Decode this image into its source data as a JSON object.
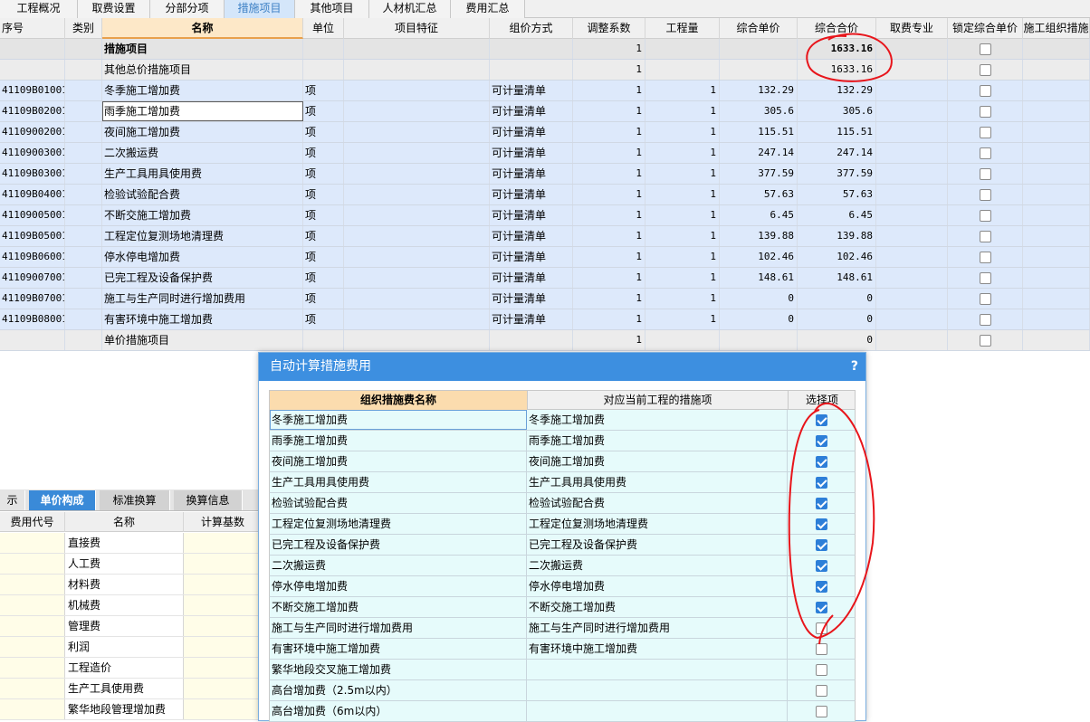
{
  "tabs": [
    "工程概况",
    "取费设置",
    "分部分项",
    "措施项目",
    "其他项目",
    "人材机汇总",
    "费用汇总"
  ],
  "active_tab": "措施项目",
  "grid": {
    "headers": [
      "序号",
      "类别",
      "名称",
      "单位",
      "项目特征",
      "组价方式",
      "调整系数",
      "工程量",
      "综合单价",
      "综合合价",
      "取费专业",
      "锁定综合单价",
      "施工组织措施"
    ],
    "rows": [
      {
        "code": "",
        "name": "措施项目",
        "unit": "",
        "method": "",
        "coef": "1",
        "qty": "",
        "price": "",
        "total": "1633.16",
        "kind": "total"
      },
      {
        "code": "",
        "name": "其他总价措施项目",
        "unit": "",
        "method": "",
        "coef": "1",
        "qty": "",
        "price": "",
        "total": "1633.16",
        "kind": "sub"
      },
      {
        "code": "41109B01001",
        "name": "冬季施工增加费",
        "unit": "项",
        "method": "可计量清单",
        "coef": "1",
        "qty": "1",
        "price": "132.29",
        "total": "132.29",
        "kind": "item"
      },
      {
        "code": "41109B02001",
        "name": "雨季施工增加费",
        "unit": "项",
        "method": "可计量清单",
        "coef": "1",
        "qty": "1",
        "price": "305.6",
        "total": "305.6",
        "kind": "item"
      },
      {
        "code": "41109002001",
        "name": "夜间施工增加费",
        "unit": "项",
        "method": "可计量清单",
        "coef": "1",
        "qty": "1",
        "price": "115.51",
        "total": "115.51",
        "kind": "item"
      },
      {
        "code": "41109003001",
        "name": "二次搬运费",
        "unit": "项",
        "method": "可计量清单",
        "coef": "1",
        "qty": "1",
        "price": "247.14",
        "total": "247.14",
        "kind": "item"
      },
      {
        "code": "41109B03001",
        "name": "生产工具用具使用费",
        "unit": "项",
        "method": "可计量清单",
        "coef": "1",
        "qty": "1",
        "price": "377.59",
        "total": "377.59",
        "kind": "item"
      },
      {
        "code": "41109B04001",
        "name": "检验试验配合费",
        "unit": "项",
        "method": "可计量清单",
        "coef": "1",
        "qty": "1",
        "price": "57.63",
        "total": "57.63",
        "kind": "item"
      },
      {
        "code": "41109005001",
        "name": "不断交施工增加费",
        "unit": "项",
        "method": "可计量清单",
        "coef": "1",
        "qty": "1",
        "price": "6.45",
        "total": "6.45",
        "kind": "item"
      },
      {
        "code": "41109B05001",
        "name": "工程定位复测场地清理费",
        "unit": "项",
        "method": "可计量清单",
        "coef": "1",
        "qty": "1",
        "price": "139.88",
        "total": "139.88",
        "kind": "item"
      },
      {
        "code": "41109B06001",
        "name": "停水停电增加费",
        "unit": "项",
        "method": "可计量清单",
        "coef": "1",
        "qty": "1",
        "price": "102.46",
        "total": "102.46",
        "kind": "item"
      },
      {
        "code": "41109007001",
        "name": "已完工程及设备保护费",
        "unit": "项",
        "method": "可计量清单",
        "coef": "1",
        "qty": "1",
        "price": "148.61",
        "total": "148.61",
        "kind": "item"
      },
      {
        "code": "41109B07001",
        "name": "施工与生产同时进行增加费用",
        "unit": "项",
        "method": "可计量清单",
        "coef": "1",
        "qty": "1",
        "price": "0",
        "total": "0",
        "kind": "item"
      },
      {
        "code": "41109B08001",
        "name": "有害环境中施工增加费",
        "unit": "项",
        "method": "可计量清单",
        "coef": "1",
        "qty": "1",
        "price": "0",
        "total": "0",
        "kind": "item"
      },
      {
        "code": "",
        "name": "单价措施项目",
        "unit": "",
        "method": "",
        "coef": "1",
        "qty": "",
        "price": "",
        "total": "0",
        "kind": "sub"
      }
    ],
    "selected_name_ellipsis": "···"
  },
  "bottom": {
    "tabs": [
      "示",
      "单价构成",
      "标准换算",
      "换算信息"
    ],
    "active_tab": "单价构成",
    "headers": [
      "费用代号",
      "名称",
      "计算基数"
    ],
    "rows": [
      "直接费",
      "人工费",
      "材料费",
      "机械费",
      "管理费",
      "利润",
      "工程造价",
      "生产工具使用费",
      "繁华地段管理增加费"
    ]
  },
  "dialog": {
    "title": "自动计算措施费用",
    "help": "?",
    "headers": [
      "组织措施费名称",
      "对应当前工程的措施项",
      "选择项"
    ],
    "rows": [
      {
        "name": "冬季施工增加费",
        "match": "冬季施工增加费",
        "checked": true
      },
      {
        "name": "雨季施工增加费",
        "match": "雨季施工增加费",
        "checked": true
      },
      {
        "name": "夜间施工增加费",
        "match": "夜间施工增加费",
        "checked": true
      },
      {
        "name": "生产工具用具使用费",
        "match": "生产工具用具使用费",
        "checked": true
      },
      {
        "name": "检验试验配合费",
        "match": "检验试验配合费",
        "checked": true
      },
      {
        "name": "工程定位复测场地清理费",
        "match": "工程定位复测场地清理费",
        "checked": true
      },
      {
        "name": "已完工程及设备保护费",
        "match": "已完工程及设备保护费",
        "checked": true
      },
      {
        "name": "二次搬运费",
        "match": "二次搬运费",
        "checked": true
      },
      {
        "name": "停水停电增加费",
        "match": "停水停电增加费",
        "checked": true
      },
      {
        "name": "不断交施工增加费",
        "match": "不断交施工增加费",
        "checked": true
      },
      {
        "name": "施工与生产同时进行增加费用",
        "match": "施工与生产同时进行增加费用",
        "checked": false
      },
      {
        "name": "有害环境中施工增加费",
        "match": "有害环境中施工增加费",
        "checked": false
      },
      {
        "name": "繁华地段交叉施工增加费",
        "match": "",
        "checked": false
      },
      {
        "name": "高台增加费（2.5m以内）",
        "match": "",
        "checked": false
      },
      {
        "name": "高台增加费（6m以内）",
        "match": "",
        "checked": false
      }
    ]
  },
  "colors": {
    "accent": "#3d8fe0",
    "annotation": "#e8151b",
    "header_orange": "#fde8c8"
  }
}
